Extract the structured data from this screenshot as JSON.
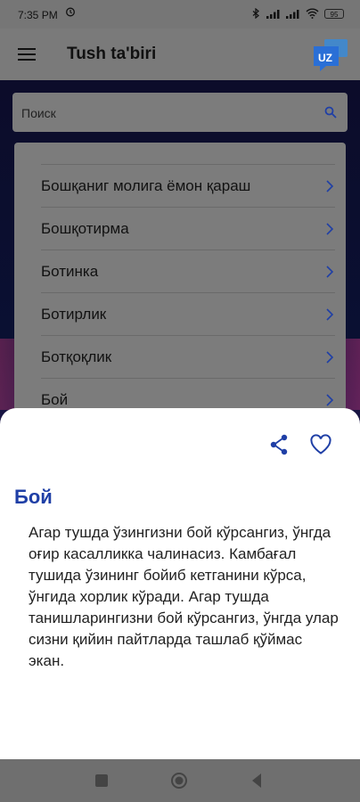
{
  "status_bar": {
    "time": "7:35 PM",
    "battery": "95"
  },
  "app_bar": {
    "title": "Tush ta'biri",
    "logo_text": "UZ"
  },
  "search": {
    "placeholder": "Поиск"
  },
  "list": {
    "items": [
      {
        "label": "Бошқаниг молига ёмон қараш"
      },
      {
        "label": "Бошқотирма"
      },
      {
        "label": "Ботинка"
      },
      {
        "label": "Ботирлик"
      },
      {
        "label": "Ботқоқлик"
      },
      {
        "label": "Бой"
      }
    ]
  },
  "sheet": {
    "word": "Бой",
    "definition": "Агар тушда ўзингизни бой кўрсангиз, ўнгда оғир касалликка чалинасиз. Камбағал тушида ўзининг бойиб кетганини кўрса, ўнгида хорлик кўради. Агар тушда танишларингизни бой кўрсангиз, ўнгда улар сизни қийин пайтларда ташлаб қўймас экан."
  },
  "colors": {
    "accent": "#1f3fa6",
    "logo": "#2a6fd6"
  }
}
